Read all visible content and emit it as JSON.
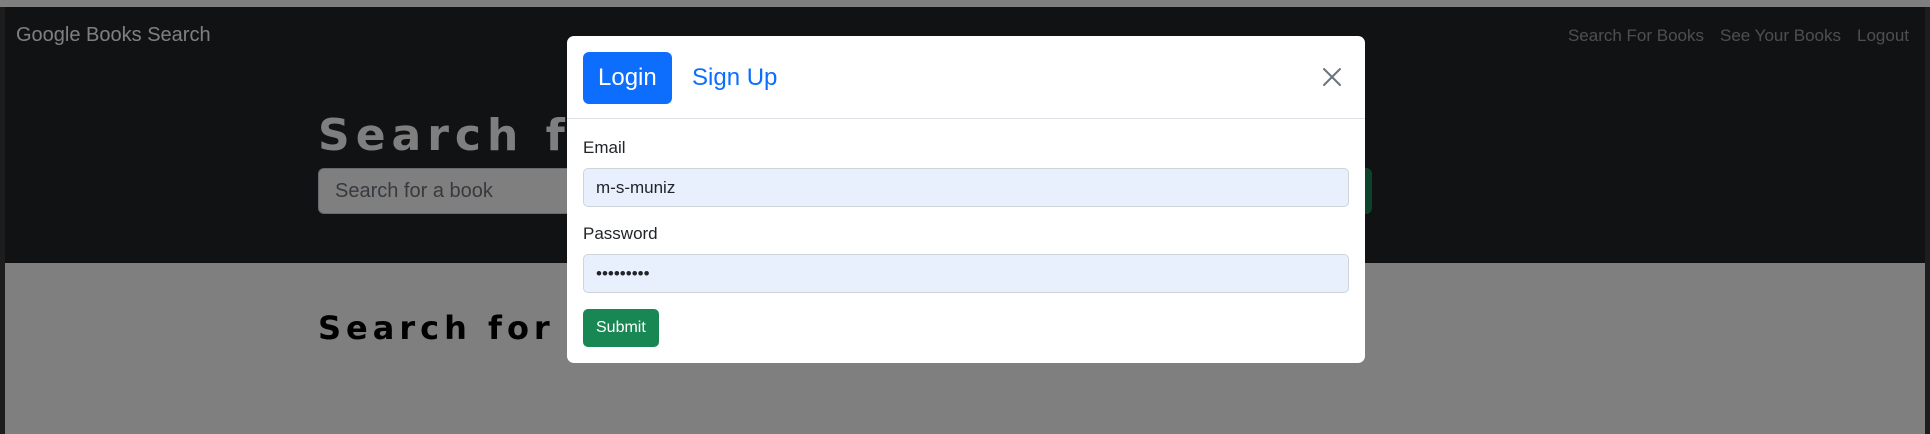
{
  "navbar": {
    "brand": "Google Books Search",
    "links": [
      "Search For Books",
      "See Your Books",
      "Logout"
    ]
  },
  "hero": {
    "title": "Search for Books!",
    "search_placeholder": "Search for a book"
  },
  "content": {
    "title": "Search for a book to begin"
  },
  "modal": {
    "tabs": {
      "login": "Login",
      "signup": "Sign Up"
    },
    "email_label": "Email",
    "email_value": "m-s-muniz",
    "password_label": "Password",
    "password_value": "•••••••••",
    "submit_label": "Submit"
  },
  "colors": {
    "primary": "#0d6efd",
    "success": "#198754",
    "navbar": "#212529",
    "autofill": "#e8f0fe"
  },
  "icons": [
    "close-icon"
  ]
}
